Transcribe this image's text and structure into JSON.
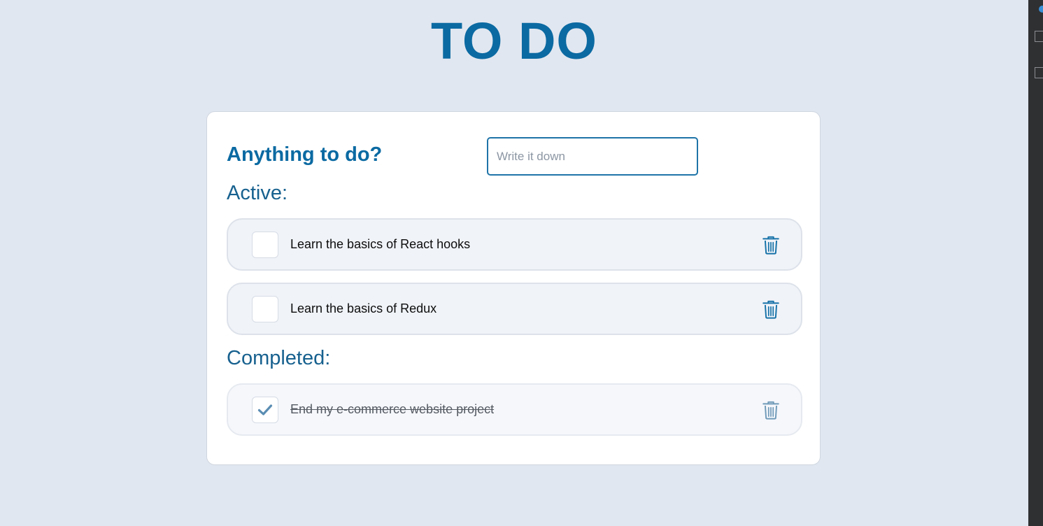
{
  "app": {
    "title": "TO DO"
  },
  "new_task": {
    "label": "Anything to do?",
    "placeholder": "Write it down",
    "value": ""
  },
  "sections": {
    "active_label": "Active:",
    "completed_label": "Completed:"
  },
  "active_tasks": [
    {
      "text": "Learn the basics of React hooks",
      "completed": false
    },
    {
      "text": "Learn the basics of Redux",
      "completed": false
    }
  ],
  "completed_tasks": [
    {
      "text": "End my e-commerce website project",
      "completed": true
    }
  ],
  "icons": {
    "delete": "trash-icon",
    "check": "check-icon"
  },
  "colors": {
    "accent": "#0b6aa2",
    "background": "#e1e7f0",
    "card": "#ffffff",
    "row": "#f0f3f8",
    "muted_icon": "#6f9ab8"
  }
}
